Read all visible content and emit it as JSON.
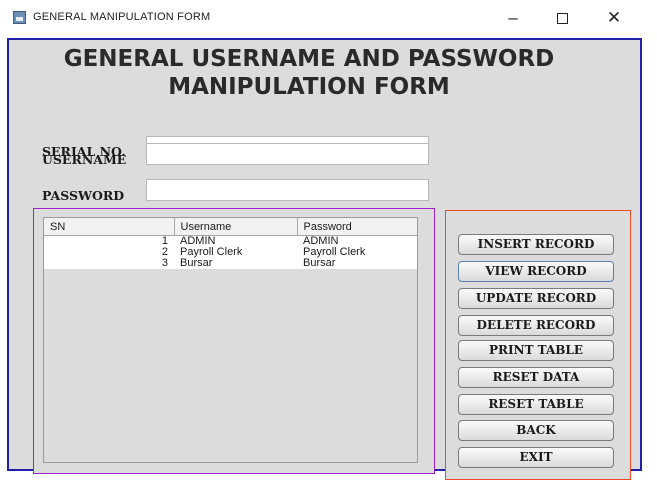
{
  "window": {
    "title": "GENERAL MANIPULATION FORM",
    "minimize": "–",
    "close": "✕"
  },
  "form": {
    "heading_line1": "GENERAL USERNAME AND PASSWORD",
    "heading_line2": "MANIPULATION FORM",
    "serial_label": "SERIAL NO.",
    "serial_value": "",
    "username_label": "USERNAME",
    "username_value": "",
    "password_label": "PASSWORD",
    "password_value": ""
  },
  "table": {
    "columns": [
      "SN",
      "Username",
      "Password"
    ],
    "rows": [
      {
        "sn": "1",
        "username": "ADMIN",
        "password": "ADMIN"
      },
      {
        "sn": "2",
        "username": "Payroll Clerk",
        "password": "Payroll Clerk"
      },
      {
        "sn": "3",
        "username": "Bursar",
        "password": "Bursar"
      }
    ]
  },
  "buttons": {
    "insert": "INSERT RECORD",
    "view": "VIEW RECORD",
    "update": "UPDATE RECORD",
    "delete": "DELETE RECORD",
    "print": "PRINT TABLE",
    "reset_data": "RESET DATA",
    "reset_table": "RESET TABLE",
    "back": "BACK",
    "exit": "EXIT"
  },
  "colors": {
    "frame_border": "#1f1fa8",
    "table_panel_border": "#a020c8",
    "button_panel_border": "#ee4a28",
    "panel_bg": "#dcdcdc"
  }
}
